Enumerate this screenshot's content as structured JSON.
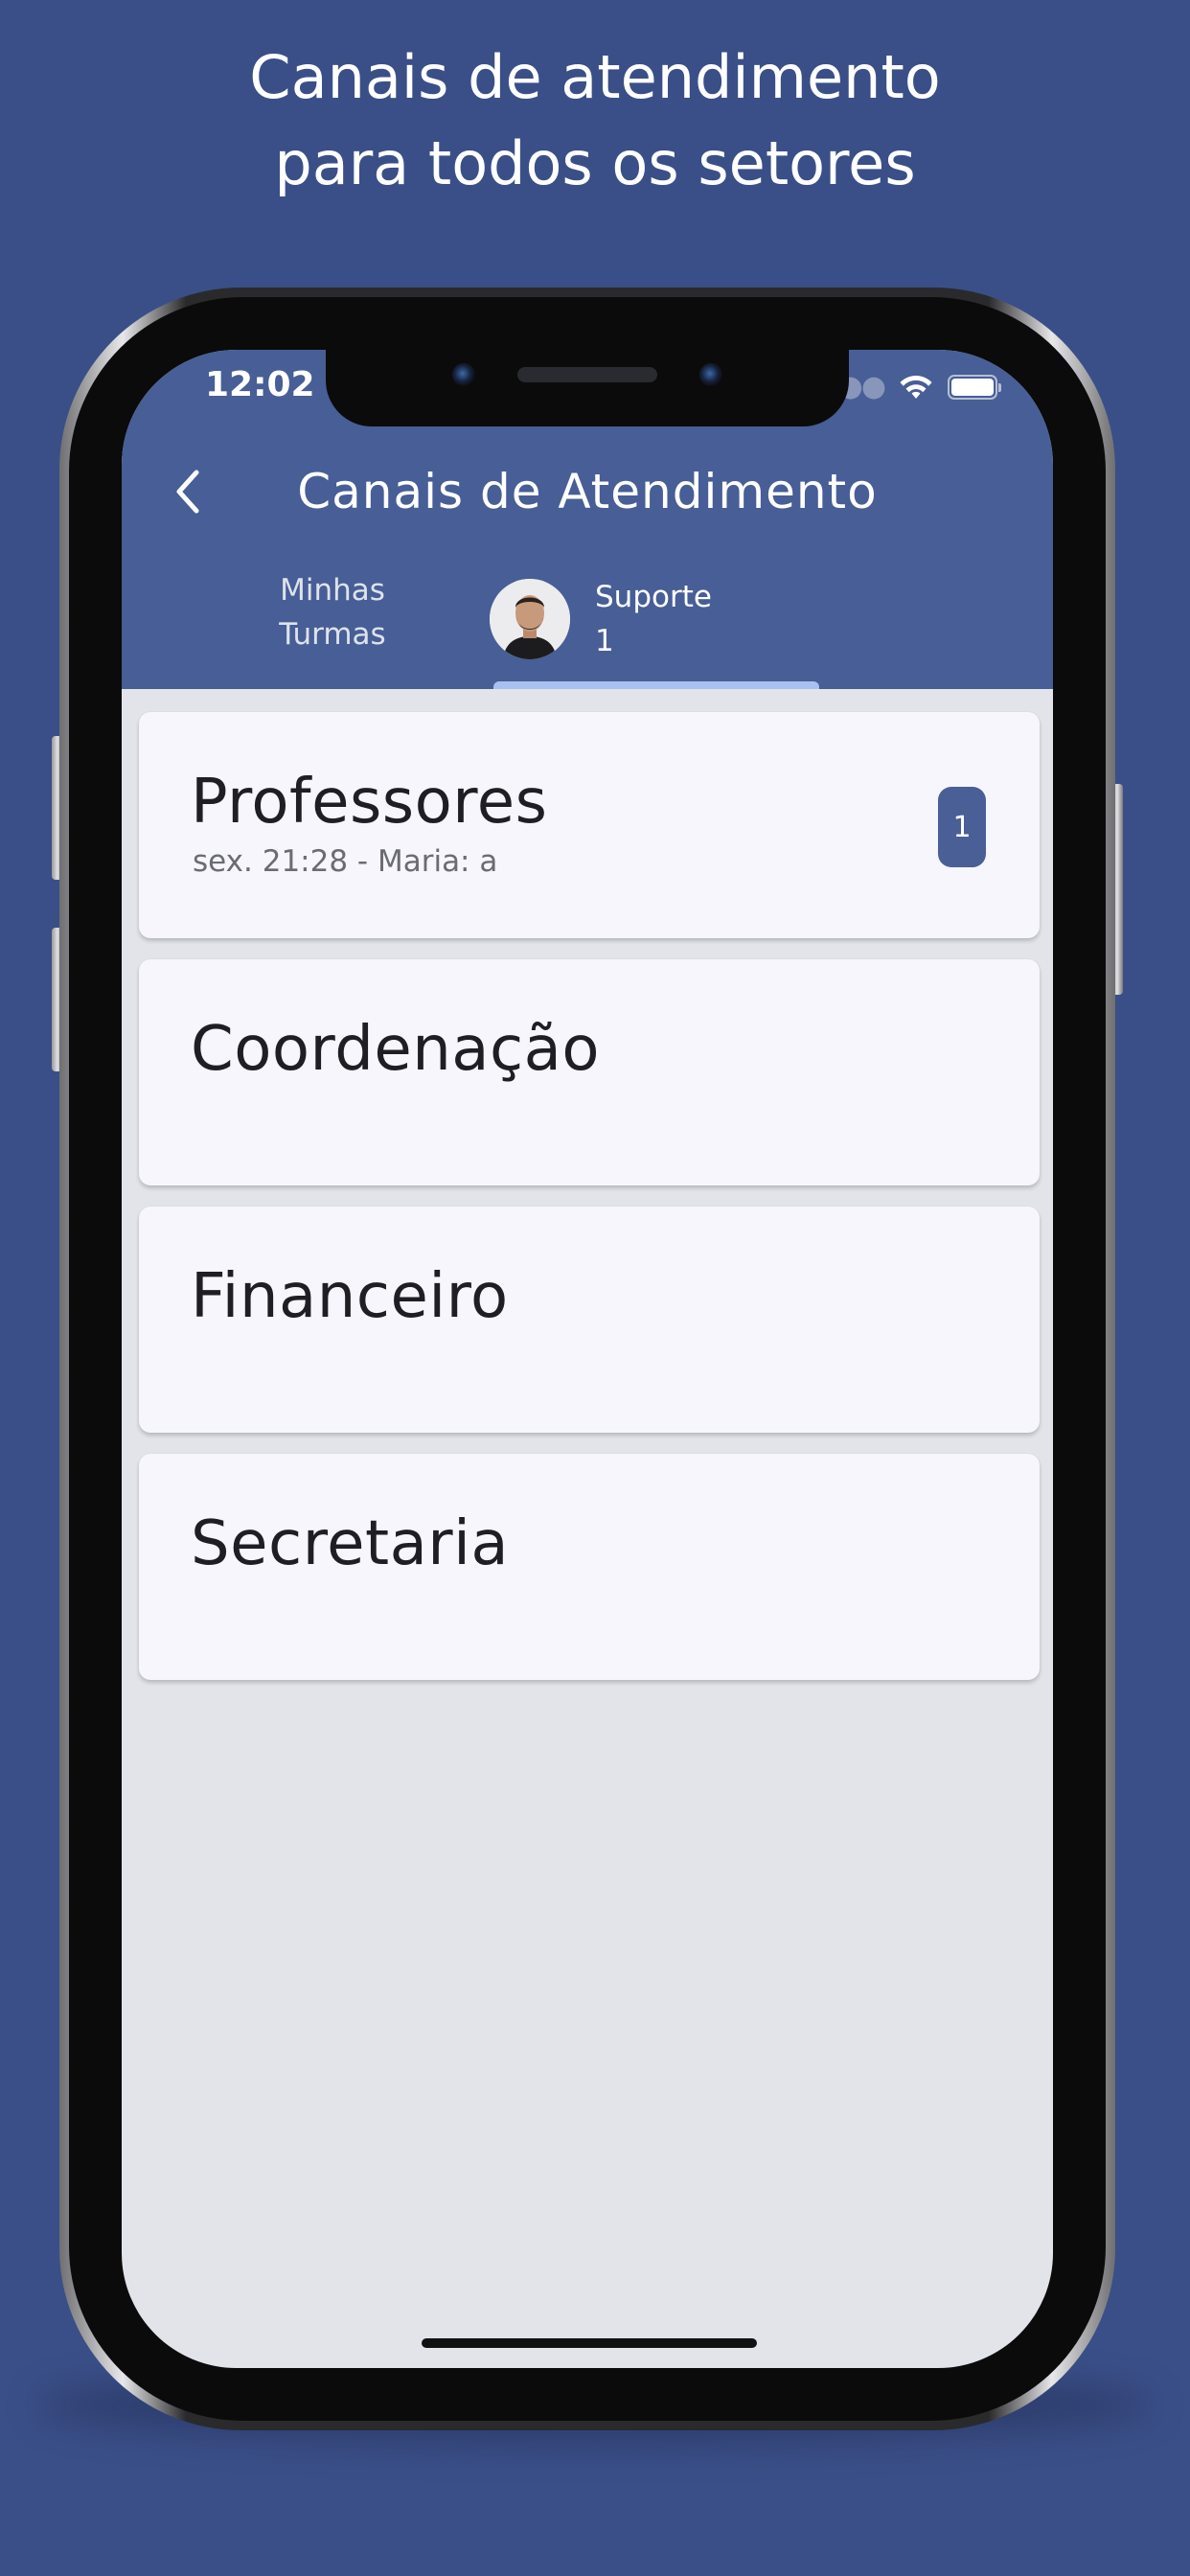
{
  "headline": {
    "line1": "Canais de atendimento",
    "line2": "para todos os setores"
  },
  "status_bar": {
    "time": "12:02"
  },
  "header": {
    "title": "Canais de Atendimento"
  },
  "tabs": {
    "turmas": {
      "line1": "Minhas",
      "line2": "Turmas"
    },
    "suporte": {
      "label": "Suporte",
      "count": "1"
    }
  },
  "channels": [
    {
      "name": "Professores",
      "last_message": "sex. 21:28 - Maria: a",
      "unread": "1"
    },
    {
      "name": "Coordenação"
    },
    {
      "name": "Financeiro"
    },
    {
      "name": "Secretaria"
    }
  ],
  "colors": {
    "background": "#3a4f87",
    "app_bar": "#475e96",
    "badge": "#4a5f95",
    "tab_indicator": "#a9c1f0",
    "list_background": "#e3e4ea",
    "card": "#f6f6fc"
  },
  "icons": {
    "back": "chevron-left-icon",
    "wifi": "wifi-icon",
    "battery": "battery-icon",
    "signal": "signal-dots-icon"
  }
}
